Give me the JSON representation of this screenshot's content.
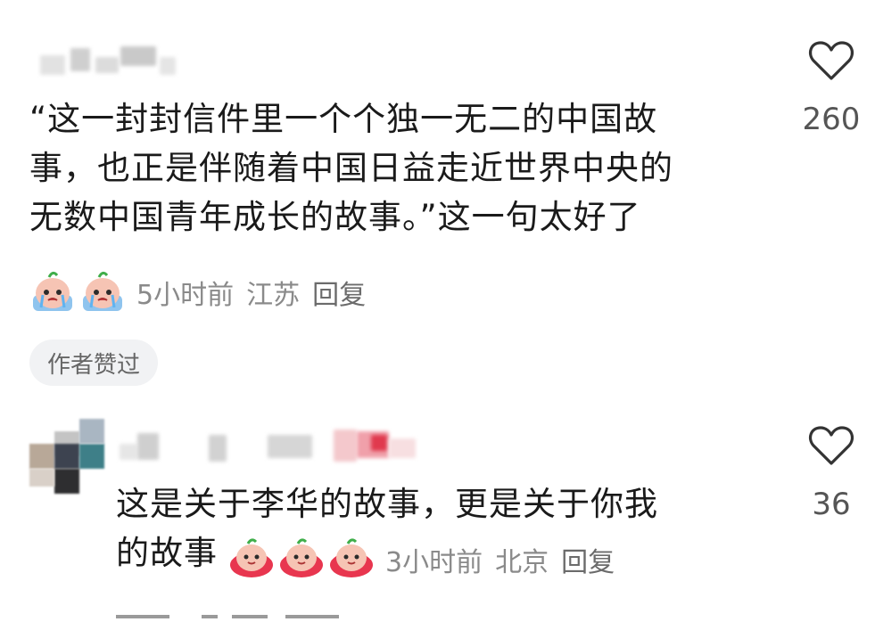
{
  "comments": [
    {
      "text_lines": [
        "“这一封封信件里一个个独一无二的中国故",
        "事，也正是伴随着中国日益走近世界中央的",
        "无数中国青年成长的故事。”这一句太好了"
      ],
      "time": "5小时前",
      "location": "江苏",
      "reply_label": "回复",
      "likes": "260",
      "badge": "作者赞过",
      "stickers": [
        "crying-sticker",
        "crying-sticker"
      ]
    },
    {
      "text_lines": [
        "这是关于李华的故事，更是关于你我",
        "的故事"
      ],
      "time": "3小时前",
      "location": "北京",
      "reply_label": "回复",
      "likes": "36",
      "stickers": [
        "cute-face-sticker",
        "cute-face-sticker",
        "cute-face-sticker"
      ]
    }
  ],
  "icons": {
    "like": "heart-outline-icon"
  },
  "colors": {
    "text": "#1a1a1a",
    "meta": "#8a8a8a",
    "badge_bg": "#f1f2f4",
    "accent_sticker": "#e8364f"
  }
}
